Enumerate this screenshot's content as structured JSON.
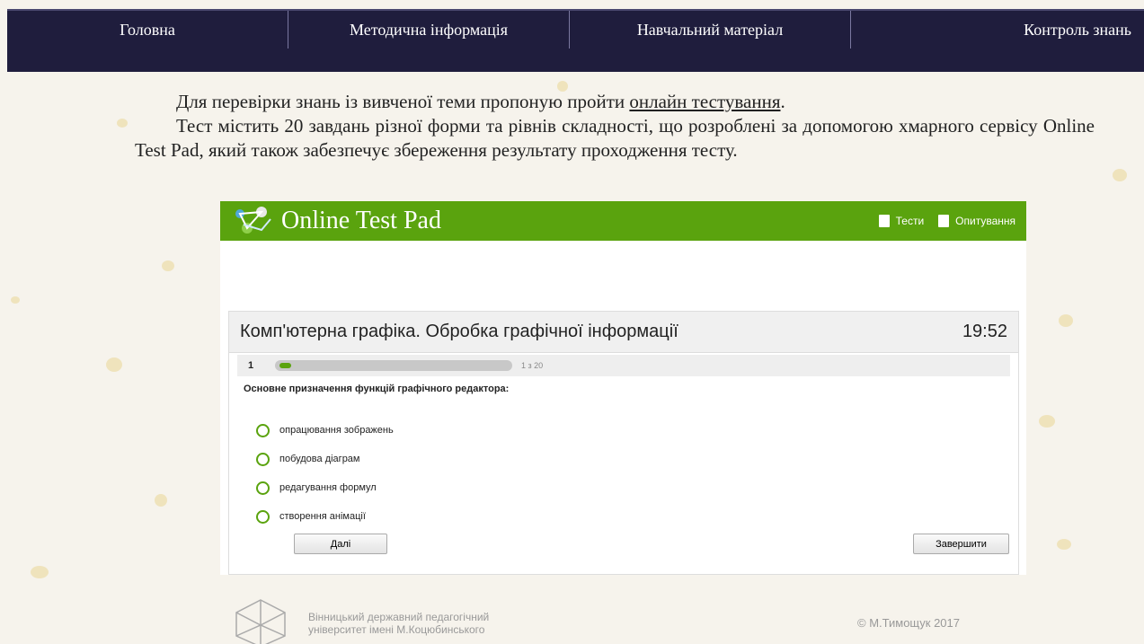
{
  "nav": {
    "items": [
      "Головна",
      "Методична інформація",
      "Навчальний матеріал",
      "Контроль знань"
    ]
  },
  "intro": {
    "p1_before": "Для перевірки знань із вивченої теми пропоную пройти ",
    "p1_link": "онлайн тестування",
    "p1_after": ".",
    "p2": "Тест містить 20 завдань різної форми та рівнів складності, що розроблені за допомогою хмарного сервісу Online Test Pad, який також забезпечує збереження результату проходження тесту."
  },
  "otp": {
    "title": "Online Test Pad",
    "menu": {
      "tests": "Тести",
      "polls": "Опитування"
    },
    "test": {
      "title": "Комп'ютерна графіка. Обробка графічної інформації",
      "timer": "19:52",
      "question_number": "1",
      "progress_text": "1 з 20",
      "progress_fraction": 0.05,
      "question": "Основне призначення функцій графічного редактора:",
      "answers": [
        "опрацювання зображень",
        "побудова діаграм",
        "редагування формул",
        "створення анімації"
      ],
      "next_label": "Далі",
      "finish_label": "Завершити"
    }
  },
  "footer": {
    "university_line1": "Вінницький державний педагогічний",
    "university_line2": "університет імені М.Коцюбинського",
    "copyright": "© М.Тимощук 2017"
  },
  "colors": {
    "nav_bg": "#1f1d3d",
    "otp_green": "#5aa30e",
    "page_bg": "#f6f3ec"
  }
}
